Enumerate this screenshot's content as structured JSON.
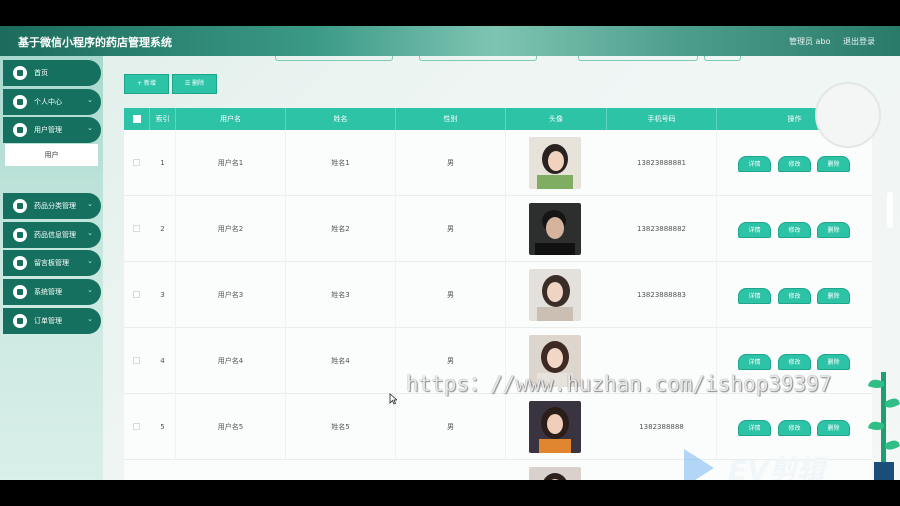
{
  "header": {
    "title": "基于微信小程序的药店管理系统",
    "admin": "管理员 abo",
    "logout": "退出登录"
  },
  "sidebar": {
    "items": [
      {
        "label": "首页",
        "chevron": ""
      },
      {
        "label": "个人中心",
        "chevron": "⌄"
      },
      {
        "label": "用户管理",
        "chevron": "⌄"
      },
      {
        "label": "药品分类管理",
        "chevron": "⌄"
      },
      {
        "label": "药品信息管理",
        "chevron": "⌄"
      },
      {
        "label": "留言板管理",
        "chevron": "⌄"
      },
      {
        "label": "系统管理",
        "chevron": "⌄"
      },
      {
        "label": "订单管理",
        "chevron": "⌄"
      }
    ],
    "submenu": "用户"
  },
  "toolbar": {
    "add": "+ 新增",
    "delete": "☰ 删除"
  },
  "table": {
    "headers": [
      "索引",
      "用户名",
      "姓名",
      "性别",
      "头像",
      "手机号码",
      "操作"
    ],
    "rows": [
      {
        "index": "1",
        "username": "用户名1",
        "name": "姓名1",
        "gender": "男",
        "phone": "13823888881"
      },
      {
        "index": "2",
        "username": "用户名2",
        "name": "姓名2",
        "gender": "男",
        "phone": "13823888882"
      },
      {
        "index": "3",
        "username": "用户名3",
        "name": "姓名3",
        "gender": "男",
        "phone": "13823888883"
      },
      {
        "index": "4",
        "username": "用户名4",
        "name": "姓名4",
        "gender": "男",
        "phone": ""
      },
      {
        "index": "5",
        "username": "用户名5",
        "name": "姓名5",
        "gender": "男",
        "phone": "1382388888"
      }
    ],
    "actions": {
      "detail": "详情",
      "edit": "修改",
      "delete": "删除"
    }
  },
  "overlay": {
    "watermark": "https：//www.huzhan.com/ishop39397",
    "brand": "EV剪辑"
  },
  "colors": {
    "accent": "#2cc3a7",
    "sidebar": "#16705f"
  }
}
